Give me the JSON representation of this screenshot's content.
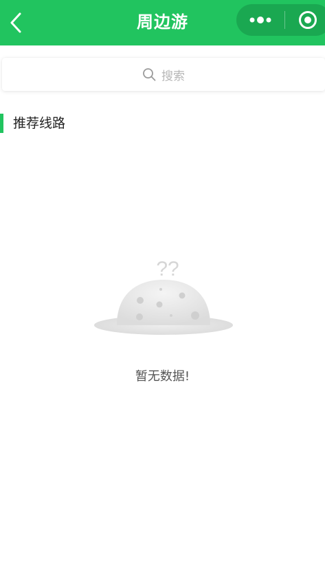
{
  "header": {
    "title": "周边游",
    "back_icon": "chevron-left-icon",
    "menu_icon": "more-dots-icon",
    "close_icon": "target-close-icon",
    "background_color": "#21c45f"
  },
  "search": {
    "placeholder": "搜索",
    "icon": "search-icon"
  },
  "section": {
    "title": "推荐线路",
    "accent_color": "#21c45f"
  },
  "empty_state": {
    "marks": "??",
    "message": "暂无数据!",
    "icon": "empty-planet-icon"
  }
}
